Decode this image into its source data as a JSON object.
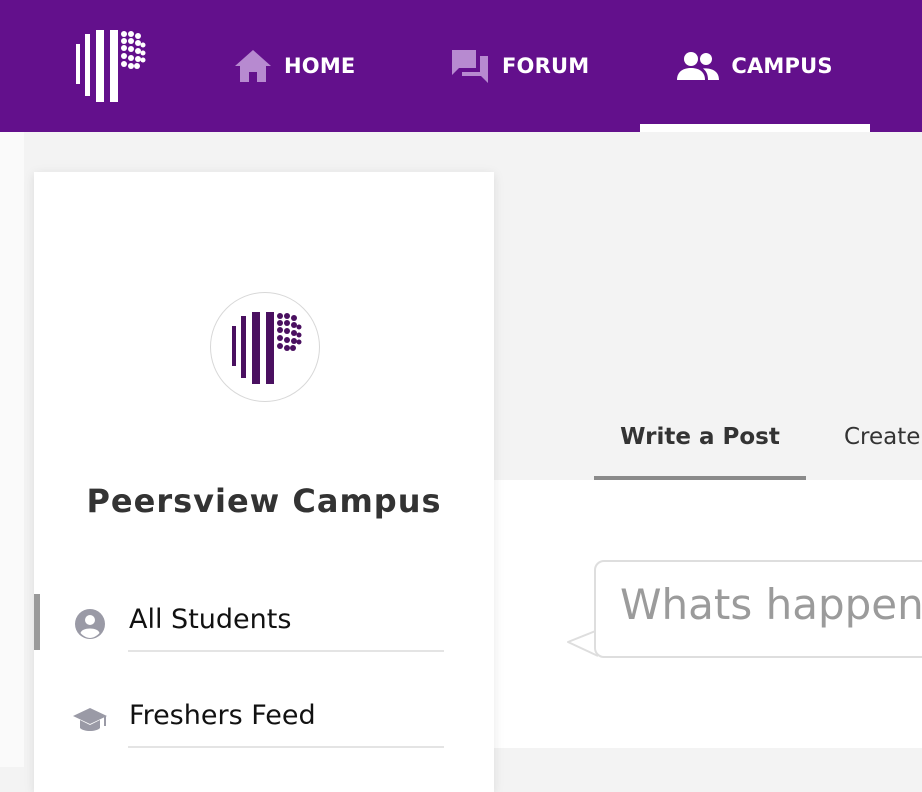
{
  "nav": {
    "items": [
      {
        "label": "HOME",
        "icon": "home-icon"
      },
      {
        "label": "FORUM",
        "icon": "forum-icon"
      },
      {
        "label": "CAMPUS",
        "icon": "people-icon",
        "active": true
      }
    ]
  },
  "sidebar": {
    "campus_name": "Peersview Campus",
    "items": [
      {
        "label": "All Students",
        "icon": "user-circle-icon",
        "active": true
      },
      {
        "label": "Freshers Feed",
        "icon": "graduation-cap-icon",
        "active": false
      }
    ]
  },
  "main": {
    "tabs": [
      {
        "label": "Write a Post",
        "active": true
      },
      {
        "label": "Create"
      }
    ],
    "post_placeholder": "Whats happening?"
  },
  "colors": {
    "brand_purple": "#63108c",
    "nav_icon_lilac": "#b78ad0",
    "logo_dark": "#4a1060"
  }
}
